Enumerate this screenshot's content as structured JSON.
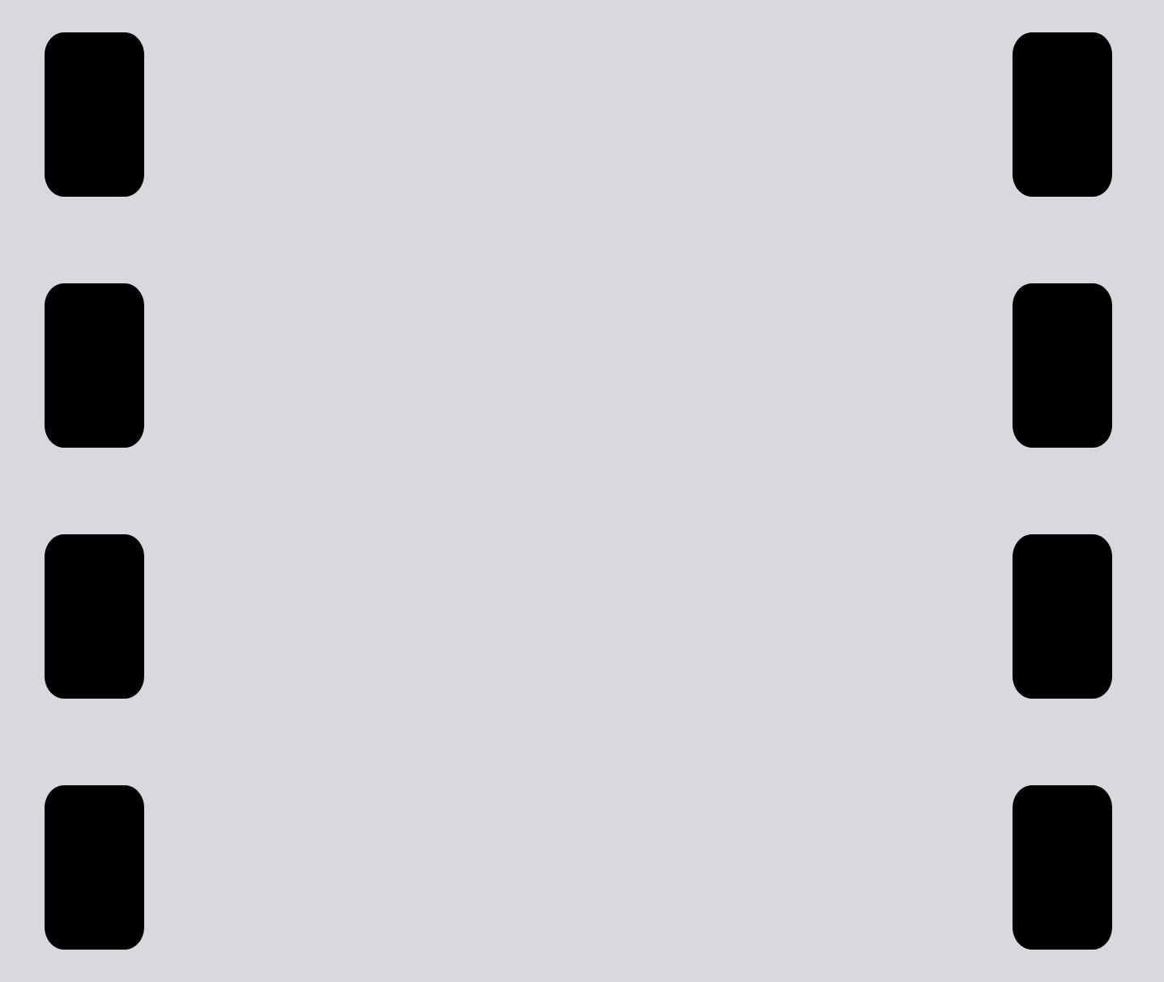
{
  "film_strip": {
    "icon": "film-strip-icon",
    "background_color": "#d8d9de",
    "perforation_color": "#000000",
    "perforations_per_side": 4,
    "sides": [
      "left",
      "right"
    ]
  }
}
